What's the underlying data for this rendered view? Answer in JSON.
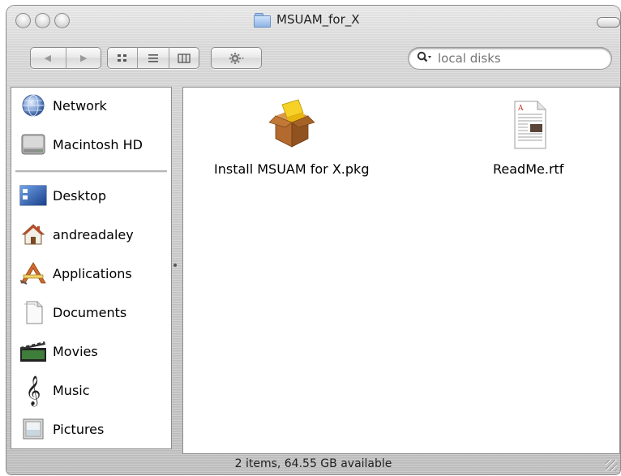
{
  "window": {
    "title": "MSUAM_for_X",
    "status": "2 items, 64.55 GB available"
  },
  "toolbar": {
    "search_placeholder": "local disks",
    "back_glyph": "◀",
    "forward_glyph": "▶"
  },
  "sidebar": {
    "devices": [
      {
        "label": "Network",
        "icon": "network-globe-icon"
      },
      {
        "label": "Macintosh HD",
        "icon": "hard-drive-icon"
      }
    ],
    "places": [
      {
        "label": "Desktop",
        "icon": "desktop-icon"
      },
      {
        "label": "andreadaley",
        "icon": "home-icon"
      },
      {
        "label": "Applications",
        "icon": "applications-icon"
      },
      {
        "label": "Documents",
        "icon": "documents-icon"
      },
      {
        "label": "Movies",
        "icon": "movies-clapper-icon"
      },
      {
        "label": "Music",
        "icon": "music-clef-icon"
      },
      {
        "label": "Pictures",
        "icon": "pictures-frame-icon"
      }
    ]
  },
  "files": [
    {
      "name": "Install MSUAM for X.pkg",
      "icon": "package-box-icon"
    },
    {
      "name": "ReadMe.rtf",
      "icon": "rtf-document-icon"
    }
  ],
  "colors": {
    "folder_blue": "#8fb5e6",
    "package_yellow": "#f2c91a",
    "package_brown": "#b36a2e"
  }
}
